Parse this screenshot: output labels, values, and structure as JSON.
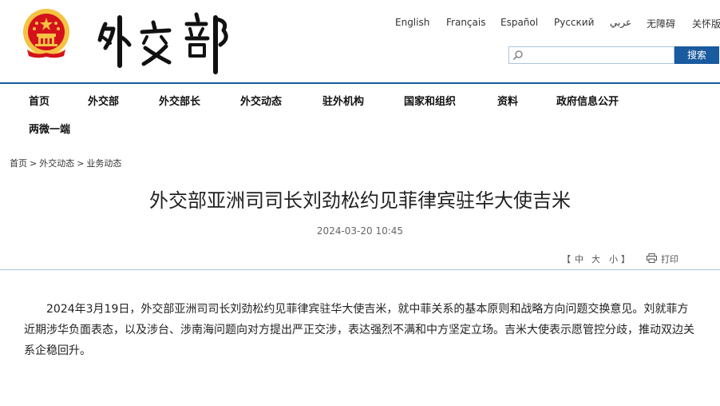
{
  "header": {
    "emblem_icon": "national-emblem-icon",
    "calligraphy_logo": "外交部",
    "languages": [
      "English",
      "Français",
      "Español",
      "Русский",
      "عربي",
      "无障碍",
      "关怀版"
    ],
    "search": {
      "placeholder": "",
      "button_label": "搜索",
      "icon": "search-icon"
    },
    "colors": {
      "accent": "#1a5a9e",
      "emblem_red": "#d4121b",
      "emblem_gold": "#f5c343"
    }
  },
  "nav": {
    "items": [
      "首页",
      "外交部",
      "外交部长",
      "外交动态",
      "驻外机构",
      "国家和组织",
      "资料",
      "政府信息公开",
      "两微一端"
    ]
  },
  "breadcrumb": {
    "items": [
      "首页",
      "外交动态",
      "业务动态"
    ],
    "separator": ">"
  },
  "article": {
    "title": "外交部亚洲司司长刘劲松约见菲律宾驻华大使吉米",
    "date": "2024-03-20 10:45",
    "font_size_tools": {
      "open_bracket": "【",
      "large": "中",
      "medium": "大",
      "small": "小",
      "close_bracket": "】"
    },
    "print_label": "打印",
    "print_icon": "printer-icon",
    "body": "2024年3月19日，外交部亚洲司司长刘劲松约见菲律宾驻华大使吉米，就中菲关系的基本原则和战略方向问题交换意见。刘就菲方近期涉华负面表态，以及涉台、涉南海问题向对方提出严正交涉，表达强烈不满和中方坚定立场。吉米大使表示愿管控分歧，推动双边关系企稳回升。"
  }
}
